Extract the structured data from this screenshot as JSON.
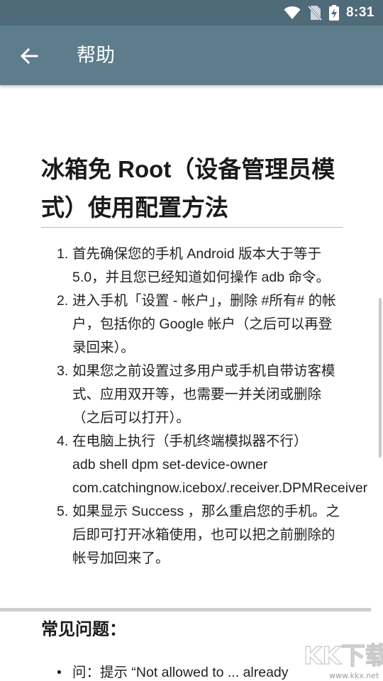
{
  "status_bar": {
    "time": "8:31"
  },
  "app_bar": {
    "title": "帮助"
  },
  "article": {
    "title": "冰箱免 Root（设备管理员模式）使用配置方法",
    "steps": [
      {
        "num": "1.",
        "text": "首先确保您的手机 Android 版本大于等于 5.0，并且您已经知道如何操作 adb 命令。"
      },
      {
        "num": "2.",
        "text": "进入手机「设置 - 帐户」，删除 #所有# 的帐户，包括你的 Google 帐户（之后可以再登录回来）。"
      },
      {
        "num": "3.",
        "text": "如果您之前设置过多用户或手机自带访客模式、应用双开等，也需要一并关闭或删除（之后可以打开）。"
      },
      {
        "num": "4.",
        "text": "在电脑上执行（手机终端模拟器不行）",
        "cmd1": "adb shell dpm set-device-owner",
        "cmd2": "com.catchingnow.icebox/.receiver.DPMReceiver"
      },
      {
        "num": "5.",
        "text": "如果显示 Success ，那么重启您的手机。之后即可打开冰箱使用，也可以把之前删除的帐号加回来了。"
      }
    ]
  },
  "faq": {
    "title": "常见问题：",
    "items": [
      {
        "bullet": "•",
        "text": "问：提示 “Not allowed to ... already"
      }
    ]
  },
  "watermark": {
    "text": "KK下载",
    "url": "www.kkx.net"
  }
}
